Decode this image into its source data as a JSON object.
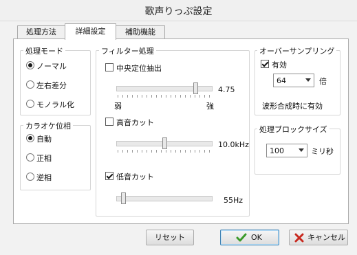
{
  "window": {
    "title": "歌声りっぷ設定"
  },
  "tabs": [
    {
      "label": "処理方法",
      "active": false
    },
    {
      "label": "詳細設定",
      "active": true
    },
    {
      "label": "補助機能",
      "active": false
    }
  ],
  "processing_mode": {
    "title": "処理モード",
    "options": [
      {
        "label": "ノーマル",
        "checked": true
      },
      {
        "label": "左右差分",
        "checked": false
      },
      {
        "label": "モノラル化",
        "checked": false
      }
    ]
  },
  "karaoke_phase": {
    "title": "カラオケ位相",
    "options": [
      {
        "label": "自動",
        "checked": true
      },
      {
        "label": "正相",
        "checked": false
      },
      {
        "label": "逆相",
        "checked": false
      }
    ]
  },
  "filter": {
    "title": "フィルター処理",
    "center": {
      "label": "中央定位抽出",
      "checked": false,
      "value_text": "4.75",
      "level": 0.84,
      "min_label": "弱",
      "max_label": "強"
    },
    "high_cut": {
      "label": "高音カット",
      "checked": false,
      "value_text": "10.0kHz",
      "level": 0.5
    },
    "low_cut": {
      "label": "低音カット",
      "checked": true,
      "value_text": "55Hz",
      "level": 0.05
    }
  },
  "oversampling": {
    "title": "オーバーサンプリング",
    "enabled_label": "有効",
    "enabled": true,
    "factor": "64",
    "factor_unit": "倍",
    "note": "波形合成時に有効"
  },
  "block_size": {
    "title": "処理ブロックサイズ",
    "value": "100",
    "unit": "ミリ秒"
  },
  "buttons": {
    "reset": "リセット",
    "ok": "OK",
    "cancel": "キャンセル"
  },
  "colors": {
    "ok_check": "#3a9a2a",
    "cancel_x": "#c8281e",
    "panel_bg": "#ffffff",
    "window_bg": "#f2f2f2"
  }
}
